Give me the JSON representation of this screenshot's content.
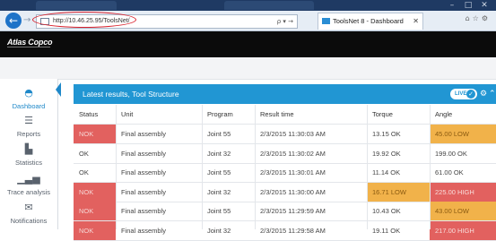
{
  "browser": {
    "url": "http://10.46.25.95/ToolsNet/",
    "address_tools": "ρ ▾ →",
    "tab_title": "ToolsNet 8 - Dashboard"
  },
  "app": {
    "logo": "Atlas Copco"
  },
  "sidebar": {
    "items": [
      {
        "label": "Dashboard",
        "icon": "dashboard-icon"
      },
      {
        "label": "Reports",
        "icon": "list-icon"
      },
      {
        "label": "Statistics",
        "icon": "bar-chart-icon"
      },
      {
        "label": "Trace analysis",
        "icon": "trace-chart-icon"
      },
      {
        "label": "Notifications",
        "icon": "mail-icon"
      }
    ]
  },
  "panel": {
    "title": "Latest results, Tool Structure",
    "live_label": "LIVE"
  },
  "table": {
    "headers": [
      "Status",
      "Unit",
      "Program",
      "Result time",
      "Torque",
      "Angle"
    ],
    "rows": [
      {
        "status": "NOK",
        "unit": "Final assembly",
        "program": "Joint 55",
        "time": "2/3/2015 11:30:03 AM",
        "torque": "13.15 OK",
        "angle": "45.00 LOW",
        "status_state": "nok",
        "torque_state": "ok",
        "angle_state": "low"
      },
      {
        "status": "OK",
        "unit": "Final assembly",
        "program": "Joint 32",
        "time": "2/3/2015 11:30:02 AM",
        "torque": "19.92 OK",
        "angle": "199.00 OK",
        "status_state": "ok",
        "torque_state": "ok",
        "angle_state": "ok"
      },
      {
        "status": "OK",
        "unit": "Final assembly",
        "program": "Joint 55",
        "time": "2/3/2015 11:30:01 AM",
        "torque": "11.14 OK",
        "angle": "61.00 OK",
        "status_state": "ok",
        "torque_state": "ok",
        "angle_state": "ok"
      },
      {
        "status": "NOK",
        "unit": "Final assembly",
        "program": "Joint 32",
        "time": "2/3/2015 11:30:00 AM",
        "torque": "16.71 LOW",
        "angle": "225.00 HIGH",
        "status_state": "nok",
        "torque_state": "low",
        "angle_state": "high"
      },
      {
        "status": "NOK",
        "unit": "Final assembly",
        "program": "Joint 55",
        "time": "2/3/2015 11:29:59 AM",
        "torque": "10.43 OK",
        "angle": "43.00 LOW",
        "status_state": "nok",
        "torque_state": "ok",
        "angle_state": "low"
      },
      {
        "status": "NOK",
        "unit": "Final assembly",
        "program": "Joint 32",
        "time": "2/3/2015 11:29:58 AM",
        "torque": "19.11 OK",
        "angle": "217.00 HIGH",
        "status_state": "nok",
        "torque_state": "ok",
        "angle_state": "high"
      }
    ]
  },
  "colors": {
    "accent": "#2196d3",
    "nok": "#e2615f",
    "low": "#f1b24a",
    "high": "#e2615f",
    "header": "#0b0b0b"
  }
}
